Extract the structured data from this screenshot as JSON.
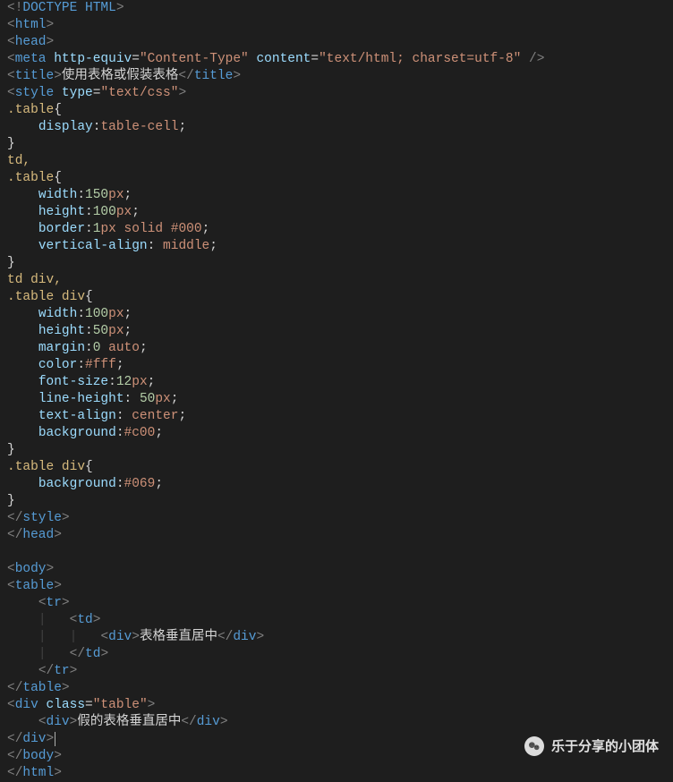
{
  "lines": {
    "l1_doctype": "DOCTYPE HTML",
    "l2_html": "html",
    "l3_head": "head",
    "l4_meta_tag": "meta",
    "l4_attr1_name": "http-equiv",
    "l4_attr1_val": "\"Content-Type\"",
    "l4_attr2_name": "content",
    "l4_attr2_val": "\"text/html; charset=utf-8\"",
    "l5_title_tag": "title",
    "l5_title_text": "使用表格或假装表格",
    "l6_style_tag": "style",
    "l6_attr_name": "type",
    "l6_attr_val": "\"text/css\"",
    "l7_sel": ".table",
    "l8_prop": "display",
    "l8_val": "table-cell",
    "l10_sel": "td,",
    "l11_sel": ".table",
    "l12_prop": "width",
    "l12_num": "150",
    "l12_unit": "px",
    "l13_prop": "height",
    "l13_num": "100",
    "l13_unit": "px",
    "l14_prop": "border",
    "l14_num": "1",
    "l14_unit": "px",
    "l14_solid": "solid",
    "l14_hex": "#000",
    "l15_prop": "vertical-align",
    "l15_val": "middle",
    "l17_sel": "td div,",
    "l18_sel1": ".table",
    "l18_sel2": "div",
    "l19_prop": "width",
    "l19_num": "100",
    "l19_unit": "px",
    "l20_prop": "height",
    "l20_num": "50",
    "l20_unit": "px",
    "l21_prop": "margin",
    "l21_num": "0",
    "l21_auto": "auto",
    "l22_prop": "color",
    "l22_hex": "#fff",
    "l23_prop": "font-size",
    "l23_num": "12",
    "l23_unit": "px",
    "l24_prop": "line-height",
    "l24_num": "50",
    "l24_unit": "px",
    "l25_prop": "text-align",
    "l25_val": "center",
    "l26_prop": "background",
    "l26_hex": "#c00",
    "l28_sel1": ".table",
    "l28_sel2": "div",
    "l29_prop": "background",
    "l29_hex": "#069",
    "l31_style_close": "style",
    "l32_head_close": "head",
    "l34_body": "body",
    "l35_table": "table",
    "l36_tr": "tr",
    "l37_td": "td",
    "l38_div": "div",
    "l38_text": "表格垂直居中",
    "l39_td_close": "td",
    "l40_tr_close": "tr",
    "l41_table_close": "table",
    "l42_div": "div",
    "l42_attr_name": "class",
    "l42_attr_val": "\"table\"",
    "l43_div": "div",
    "l43_text": "假的表格垂直居中",
    "l44_div_close": "div",
    "l45_body_close": "body",
    "l46_html_close": "html"
  },
  "watermark": "乐于分享的小团体"
}
